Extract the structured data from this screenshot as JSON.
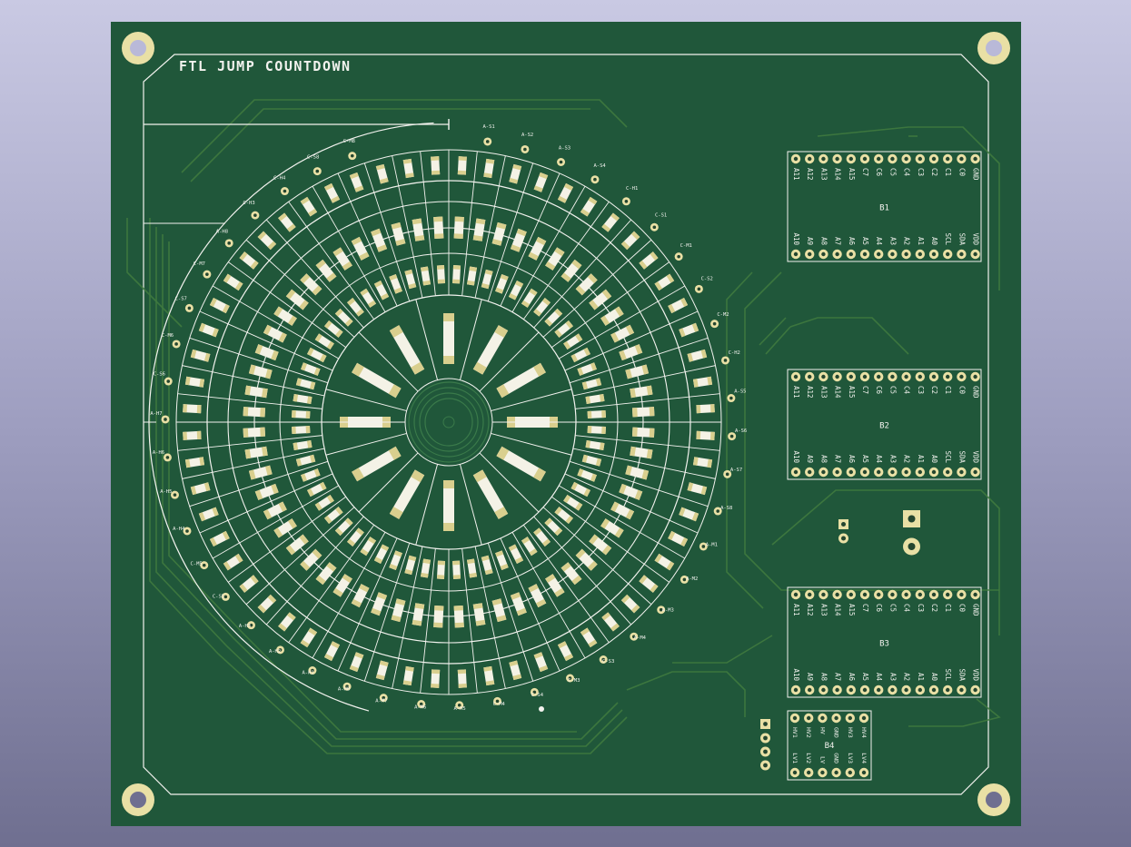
{
  "board": {
    "title": "FTL JUMP COUNTDOWN",
    "colors": {
      "background_top": "#c9c9e3",
      "board": "#20573a",
      "silkscreen": "#f2f2ee",
      "pad": "#e9e0a5",
      "trace": "#3f7a3f"
    }
  },
  "ring_labels": [
    "A-S1",
    "A-S2",
    "A-S3",
    "A-S4",
    "C-H1",
    "C-S1",
    "C-M1",
    "C-S2",
    "C-M2",
    "C-H2",
    "A-S5",
    "A-S6",
    "A-S7",
    "A-S8",
    "A-M1",
    "A-M2",
    "A-M3",
    "A-M4",
    "C-S3",
    "C-M3",
    "C-S4",
    "C-M4",
    "A-H5",
    "A-M6",
    "A-M7",
    "A-H8",
    "A-H1",
    "A-H2",
    "A-H3",
    "C-S5",
    "C-M5",
    "A-H4",
    "A-H5",
    "A-H6",
    "A-H7",
    "C-S6",
    "C-M6",
    "C-S7",
    "C-M7",
    "A-H8",
    "C-H3",
    "C-H4",
    "C-S8",
    "C-M8"
  ],
  "headers": [
    {
      "name": "B1",
      "top_pins": [
        "A11",
        "A12",
        "A13",
        "A14",
        "A15",
        "C7",
        "C6",
        "C5",
        "C4",
        "C3",
        "C2",
        "C1",
        "C0",
        "GND"
      ],
      "bottom_pins": [
        "A10",
        "A9",
        "A8",
        "A7",
        "A6",
        "A5",
        "A4",
        "A3",
        "A2",
        "A1",
        "A0",
        "SCL",
        "SDA",
        "VDD"
      ]
    },
    {
      "name": "B2",
      "top_pins": [
        "A11",
        "A12",
        "A13",
        "A14",
        "A15",
        "C7",
        "C6",
        "C5",
        "C4",
        "C3",
        "C2",
        "C1",
        "C0",
        "GND"
      ],
      "bottom_pins": [
        "A10",
        "A9",
        "A8",
        "A7",
        "A6",
        "A5",
        "A4",
        "A3",
        "A2",
        "A1",
        "A0",
        "SCL",
        "SDA",
        "VDD"
      ]
    },
    {
      "name": "B3",
      "top_pins": [
        "A11",
        "A12",
        "A13",
        "A14",
        "A15",
        "C7",
        "C6",
        "C5",
        "C4",
        "C3",
        "C2",
        "C1",
        "C0",
        "GND"
      ],
      "bottom_pins": [
        "A10",
        "A9",
        "A8",
        "A7",
        "A6",
        "A5",
        "A4",
        "A3",
        "A2",
        "A1",
        "A0",
        "SCL",
        "SDA",
        "VDD"
      ]
    }
  ],
  "level_shifter": {
    "name": "B4",
    "top_pins": [
      "HV1",
      "HV2",
      "HV",
      "GND",
      "HV3",
      "HV4"
    ],
    "bottom_pins": [
      "LV1",
      "LV2",
      "LV",
      "GND",
      "LV3",
      "LV4"
    ]
  }
}
